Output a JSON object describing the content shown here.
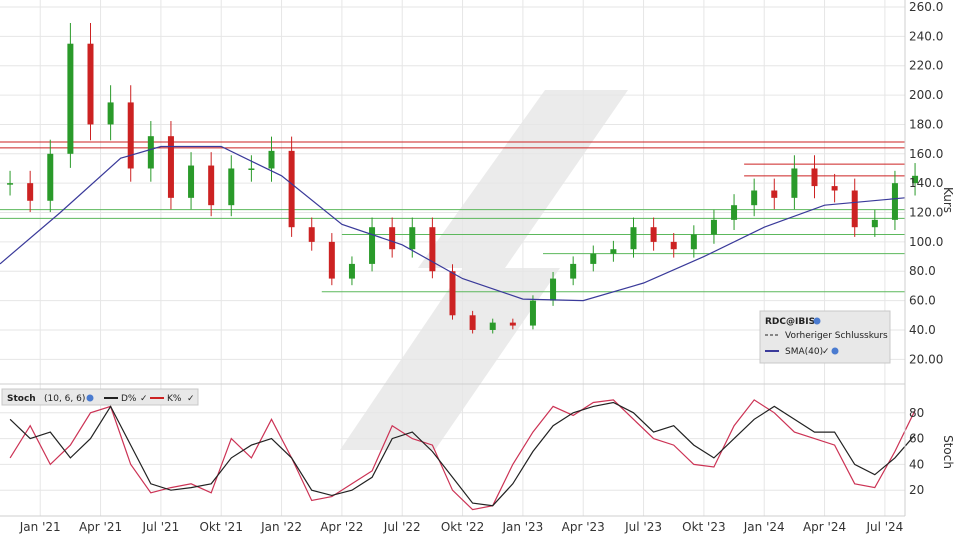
{
  "chart_data": [
    {
      "type": "candlestick",
      "symbol": "RDC@IBIS",
      "ylabel": "Kurs",
      "ylim": [
        10,
        260
      ],
      "y_ticks": [
        "260.0",
        "240.0",
        "220.0",
        "200.0",
        "180.0",
        "160.0",
        "140.0",
        "120.0",
        "100.0",
        "80.0",
        "60.0",
        "40.0",
        "20.00"
      ],
      "x_ticks": [
        "Jan '21",
        "Apr '21",
        "Jul '21",
        "Okt '21",
        "Jan '22",
        "Apr '22",
        "Jul '22",
        "Okt '22",
        "Jan '23",
        "Apr '23",
        "Jul '23",
        "Okt '23",
        "Jan '24",
        "Apr '24",
        "Jul '24"
      ],
      "x_range": [
        "2020-11",
        "2024-08"
      ],
      "grid": true,
      "series": [
        {
          "name": "",
          "kind": "close_price",
          "color_up": "#2a9a2a",
          "color_down": "#cc2222",
          "x": [
            "2020-11",
            "2020-12",
            "2021-01",
            "2021-02",
            "2021-03",
            "2021-04",
            "2021-05",
            "2021-06",
            "2021-07",
            "2021-08",
            "2021-09",
            "2021-10",
            "2021-11",
            "2021-12",
            "2022-01",
            "2022-02",
            "2022-03",
            "2022-04",
            "2022-05",
            "2022-06",
            "2022-07",
            "2022-08",
            "2022-09",
            "2022-10",
            "2022-11",
            "2022-12",
            "2023-01",
            "2023-02",
            "2023-03",
            "2023-04",
            "2023-05",
            "2023-06",
            "2023-07",
            "2023-08",
            "2023-09",
            "2023-10",
            "2023-11",
            "2023-12",
            "2024-01",
            "2024-02",
            "2024-03",
            "2024-04",
            "2024-05",
            "2024-06",
            "2024-07",
            "2024-08"
          ],
          "values": [
            140,
            128,
            160,
            235,
            180,
            195,
            150,
            172,
            130,
            152,
            125,
            150,
            150,
            162,
            110,
            100,
            75,
            85,
            110,
            95,
            110,
            80,
            50,
            40,
            45,
            43,
            60,
            75,
            85,
            92,
            95,
            110,
            100,
            95,
            105,
            115,
            125,
            135,
            130,
            150,
            138,
            135,
            110,
            115,
            140,
            145
          ]
        },
        {
          "name": "SMA(40)",
          "kind": "line",
          "color": "#3a3a9a",
          "x": [
            "2020-11",
            "2021-02",
            "2021-05",
            "2021-07",
            "2021-10",
            "2022-01",
            "2022-04",
            "2022-07",
            "2022-10",
            "2023-01",
            "2023-04",
            "2023-07",
            "2023-10",
            "2024-01",
            "2024-04",
            "2024-08"
          ],
          "values": [
            85,
            120,
            157,
            165,
            165,
            145,
            112,
            98,
            75,
            61,
            60,
            72,
            90,
            110,
            125,
            130
          ]
        },
        {
          "name": "Vorheriger Schlusskurs",
          "kind": "dashed_line"
        }
      ],
      "horizontal_levels": {
        "red": [
          168,
          164,
          153,
          145
        ],
        "green": [
          122,
          116,
          105,
          92,
          66
        ]
      },
      "legend": [
        "RDC@IBIS",
        "Vorheriger Schlusskurs",
        "SMA(40)"
      ],
      "legend_position": "bottom-right"
    },
    {
      "type": "line",
      "title": "Stoch",
      "params": "(10, 6, 6)",
      "ylabel": "Stoch",
      "ylim": [
        0,
        100
      ],
      "y_ticks": [
        "80",
        "60",
        "40",
        "20"
      ],
      "series": [
        {
          "name": "D%",
          "color": "#222222",
          "x": [
            "2020-11",
            "2020-12",
            "2021-01",
            "2021-02",
            "2021-03",
            "2021-04",
            "2021-05",
            "2021-06",
            "2021-07",
            "2021-08",
            "2021-09",
            "2021-10",
            "2021-11",
            "2021-12",
            "2022-01",
            "2022-02",
            "2022-03",
            "2022-04",
            "2022-05",
            "2022-06",
            "2022-07",
            "2022-08",
            "2022-09",
            "2022-10",
            "2022-11",
            "2022-12",
            "2023-01",
            "2023-02",
            "2023-03",
            "2023-04",
            "2023-05",
            "2023-06",
            "2023-07",
            "2023-08",
            "2023-09",
            "2023-10",
            "2023-11",
            "2023-12",
            "2024-01",
            "2024-02",
            "2024-03",
            "2024-04",
            "2024-05",
            "2024-06",
            "2024-07",
            "2024-08"
          ],
          "values": [
            75,
            60,
            65,
            45,
            60,
            85,
            55,
            25,
            20,
            22,
            25,
            45,
            55,
            60,
            45,
            20,
            16,
            20,
            30,
            60,
            65,
            50,
            30,
            10,
            8,
            25,
            50,
            70,
            80,
            85,
            88,
            80,
            65,
            70,
            55,
            45,
            60,
            75,
            85,
            75,
            65,
            65,
            40,
            32,
            45,
            63
          ]
        },
        {
          "name": "K%",
          "color": "#cc3355",
          "x": [
            "2020-11",
            "2020-12",
            "2021-01",
            "2021-02",
            "2021-03",
            "2021-04",
            "2021-05",
            "2021-06",
            "2021-07",
            "2021-08",
            "2021-09",
            "2021-10",
            "2021-11",
            "2021-12",
            "2022-01",
            "2022-02",
            "2022-03",
            "2022-04",
            "2022-05",
            "2022-06",
            "2022-07",
            "2022-08",
            "2022-09",
            "2022-10",
            "2022-11",
            "2022-12",
            "2023-01",
            "2023-02",
            "2023-03",
            "2023-04",
            "2023-05",
            "2023-06",
            "2023-07",
            "2023-08",
            "2023-09",
            "2023-10",
            "2023-11",
            "2023-12",
            "2024-01",
            "2024-02",
            "2024-03",
            "2024-04",
            "2024-05",
            "2024-06",
            "2024-07",
            "2024-08"
          ],
          "values": [
            45,
            70,
            40,
            55,
            80,
            85,
            40,
            18,
            22,
            25,
            18,
            60,
            45,
            75,
            45,
            12,
            15,
            25,
            35,
            70,
            60,
            55,
            20,
            5,
            8,
            40,
            65,
            85,
            78,
            88,
            90,
            75,
            60,
            55,
            40,
            38,
            70,
            90,
            80,
            65,
            60,
            55,
            25,
            22,
            50,
            82
          ]
        }
      ],
      "legend": [
        "Stoch",
        "(10, 6, 6)",
        "D%",
        "K%"
      ],
      "legend_position": "top-left"
    }
  ]
}
